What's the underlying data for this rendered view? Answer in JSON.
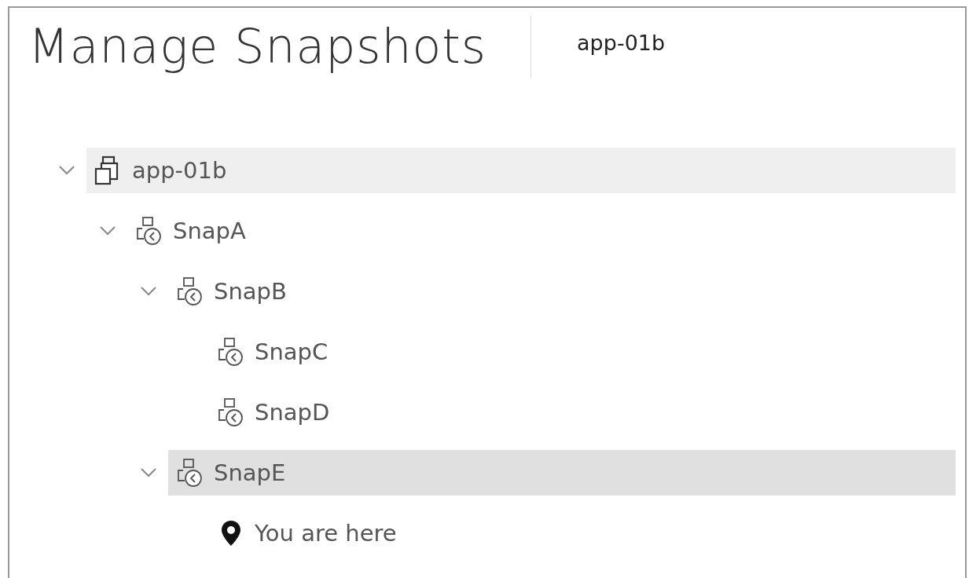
{
  "header": {
    "title": "Manage Snapshots",
    "subtitle": "app-01b"
  },
  "tree": [
    {
      "kind": "vm",
      "label": "app-01b",
      "expanded": true,
      "selected": false,
      "hovered": true,
      "children": [
        {
          "kind": "snapshot",
          "label": "SnapA",
          "expanded": true,
          "selected": false,
          "hovered": false,
          "children": [
            {
              "kind": "snapshot",
              "label": "SnapB",
              "expanded": true,
              "selected": false,
              "hovered": false,
              "children": [
                {
                  "kind": "snapshot",
                  "label": "SnapC",
                  "selected": false,
                  "hovered": false
                },
                {
                  "kind": "snapshot",
                  "label": "SnapD",
                  "selected": false,
                  "hovered": false
                }
              ]
            },
            {
              "kind": "snapshot",
              "label": "SnapE",
              "expanded": true,
              "selected": true,
              "hovered": false,
              "children": [
                {
                  "kind": "here",
                  "label": "You are here",
                  "selected": false,
                  "hovered": false
                }
              ]
            }
          ]
        }
      ]
    }
  ]
}
